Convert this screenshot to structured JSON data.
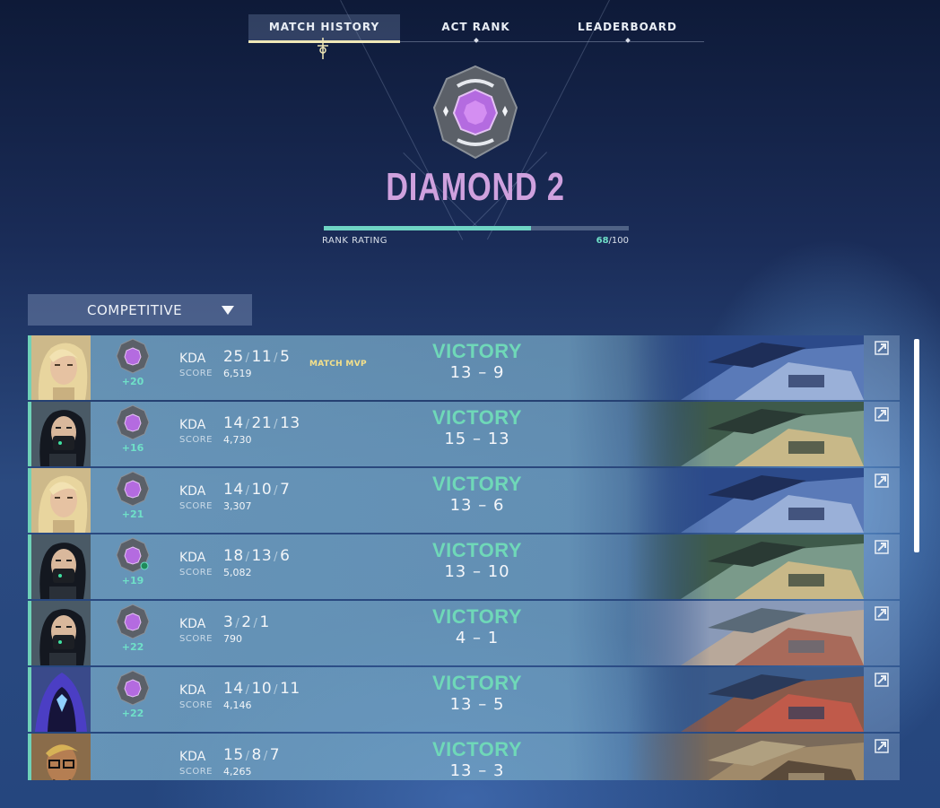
{
  "tabs": [
    {
      "label": "MATCH HISTORY",
      "active": true
    },
    {
      "label": "ACT RANK",
      "active": false
    },
    {
      "label": "LEADERBOARD",
      "active": false
    }
  ],
  "rank": {
    "title": "DIAMOND 2",
    "rating_label": "RANK RATING",
    "rating_current": "68",
    "rating_separator": "/",
    "rating_max": "100",
    "rating_fraction": 0.68,
    "title_color": "#cfa1de",
    "gem_color": "#b46be0"
  },
  "mode_select": {
    "value": "COMPETITIVE",
    "icon": "caret-down-icon"
  },
  "colors": {
    "accent_teal": "#6fd8b8",
    "mvp_gold": "#f4e08a",
    "tab_underline": "#efe7b6"
  },
  "matches": [
    {
      "agent": "blonde-agent-portrait",
      "rr_change": "+20",
      "kda_label": "KDA",
      "kills": "25",
      "deaths": "11",
      "assists": "5",
      "score_label": "SCORE",
      "score": "6,519",
      "mvp": "MATCH MVP",
      "result": "VICTORY",
      "score_a": "13",
      "dash": "–",
      "score_b": "9",
      "map": "rooftop-map"
    },
    {
      "agent": "masked-agent-portrait",
      "rr_change": "+16",
      "kda_label": "KDA",
      "kills": "14",
      "deaths": "21",
      "assists": "13",
      "score_label": "SCORE",
      "score": "4,730",
      "mvp": "",
      "result": "VICTORY",
      "score_a": "15",
      "dash": "–",
      "score_b": "13",
      "map": "courtyard-map"
    },
    {
      "agent": "blonde-agent-portrait",
      "rr_change": "+21",
      "kda_label": "KDA",
      "kills": "14",
      "deaths": "10",
      "assists": "7",
      "score_label": "SCORE",
      "score": "3,307",
      "mvp": "",
      "result": "VICTORY",
      "score_a": "13",
      "dash": "–",
      "score_b": "6",
      "map": "rooftop-map"
    },
    {
      "agent": "masked-agent-portrait",
      "rr_change": "+19",
      "kda_label": "KDA",
      "kills": "18",
      "deaths": "13",
      "assists": "6",
      "score_label": "SCORE",
      "score": "5,082",
      "mvp": "",
      "result": "VICTORY",
      "score_a": "13",
      "dash": "–",
      "score_b": "10",
      "map": "courtyard-map"
    },
    {
      "agent": "masked-agent-portrait",
      "rr_change": "+22",
      "kda_label": "KDA",
      "kills": "3",
      "deaths": "2",
      "assists": "1",
      "score_label": "SCORE",
      "score": "790",
      "mvp": "",
      "result": "VICTORY",
      "score_a": "4",
      "dash": "–",
      "score_b": "1",
      "map": "town-map"
    },
    {
      "agent": "hooded-agent-portrait",
      "rr_change": "+22",
      "kda_label": "KDA",
      "kills": "14",
      "deaths": "10",
      "assists": "11",
      "score_label": "SCORE",
      "score": "4,146",
      "mvp": "",
      "result": "VICTORY",
      "score_a": "13",
      "dash": "–",
      "score_b": "5",
      "map": "city-map"
    },
    {
      "agent": "glasses-agent-portrait",
      "rr_change": "",
      "kda_label": "KDA",
      "kills": "15",
      "deaths": "8",
      "assists": "7",
      "score_label": "SCORE",
      "score": "4,265",
      "mvp": "",
      "result": "VICTORY",
      "score_a": "13",
      "dash": "–",
      "score_b": "3",
      "map": "market-map"
    }
  ]
}
